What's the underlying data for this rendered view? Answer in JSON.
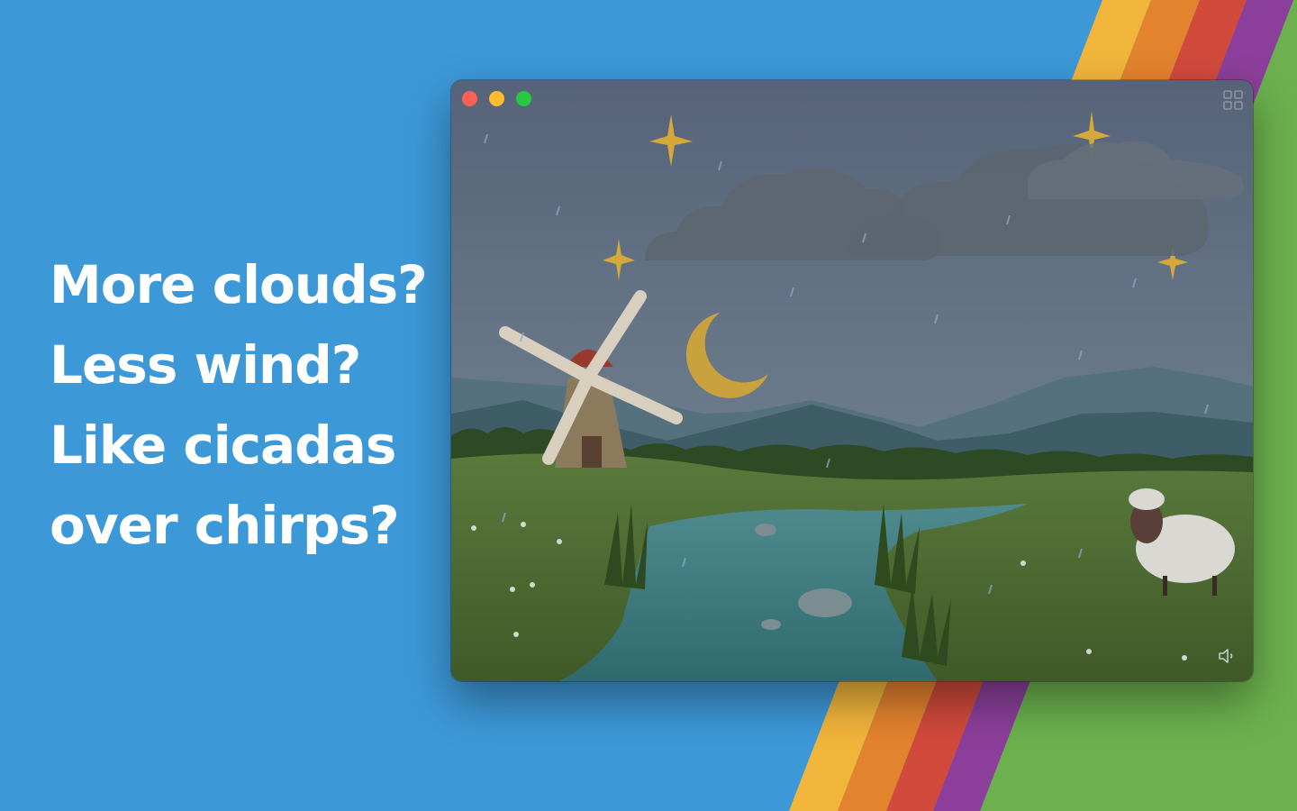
{
  "tagline": {
    "line1": "More clouds?",
    "line2": "Less wind?",
    "line3": "Like cicadas",
    "line4": "over chirps?"
  },
  "colors": {
    "background": "#3d98d8",
    "green_panel": "#6cb14e",
    "stripes": [
      "#f2b53b",
      "#e4832e",
      "#d14a3c",
      "#8c3f9a"
    ]
  },
  "window": {
    "controls": [
      "close",
      "minimize",
      "zoom"
    ],
    "icons": {
      "top_right": "grid-icon",
      "bottom_right": "speaker-icon"
    }
  },
  "scene": {
    "elements": [
      "stars",
      "clouds",
      "crescent-moon",
      "mountains",
      "windmill",
      "stream",
      "reeds",
      "rocks",
      "sheep",
      "rain",
      "flowers"
    ]
  }
}
